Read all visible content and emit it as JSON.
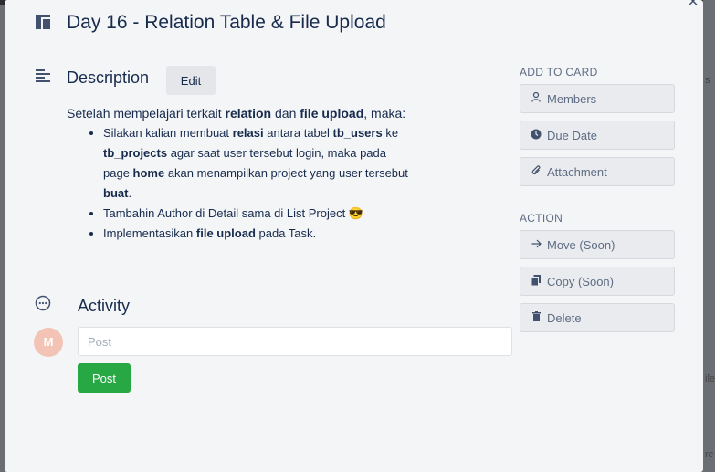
{
  "card": {
    "title": "Day 16 - Relation Table & File Upload",
    "close_symbol": "×"
  },
  "description": {
    "heading": "Description",
    "edit_label": "Edit",
    "intro_pre": "Setelah mempelajari terkait ",
    "intro_b1": "relation",
    "intro_mid": " dan ",
    "intro_b2": "file upload",
    "intro_post": ", maka:",
    "items": [
      {
        "t1": "Silakan kalian membuat ",
        "b1": "relasi",
        "t2": " antara tabel ",
        "b2": "tb_users",
        "t3": " ke ",
        "b3": "tb_projects",
        "t4": " agar saat user tersebut login, maka pada page ",
        "b4": "home",
        "t5": " akan menampilkan project yang user tersebut ",
        "b5": "buat",
        "t6": "."
      },
      {
        "text": "Tambahin Author di Detail sama di List Project",
        "emoji": "😎"
      },
      {
        "t1": "Implementasikan ",
        "b1": "file upload",
        "t2": " pada Task."
      }
    ]
  },
  "activity": {
    "heading": "Activity",
    "avatar_initial": "M",
    "input_placeholder": "Post",
    "post_label": "Post"
  },
  "sidebar": {
    "add_title": "ADD TO CARD",
    "add_buttons": [
      {
        "label": "Members",
        "icon": "person-icon"
      },
      {
        "label": "Due Date",
        "icon": "clock-icon"
      },
      {
        "label": "Attachment",
        "icon": "paperclip-icon"
      }
    ],
    "action_title": "ACTION",
    "action_buttons": [
      {
        "label": "Move (Soon)",
        "icon": "arrow-right-icon"
      },
      {
        "label": "Copy (Soon)",
        "icon": "copy-icon"
      },
      {
        "label": "Delete",
        "icon": "trash-icon"
      }
    ]
  },
  "background": {
    "edge_texts": [
      "s",
      "ile",
      "rc"
    ]
  },
  "colors": {
    "modal_bg": "#f4f5f7",
    "text_primary": "#172b4d",
    "post_button": "#28a745",
    "avatar": "#f3c4b6"
  }
}
